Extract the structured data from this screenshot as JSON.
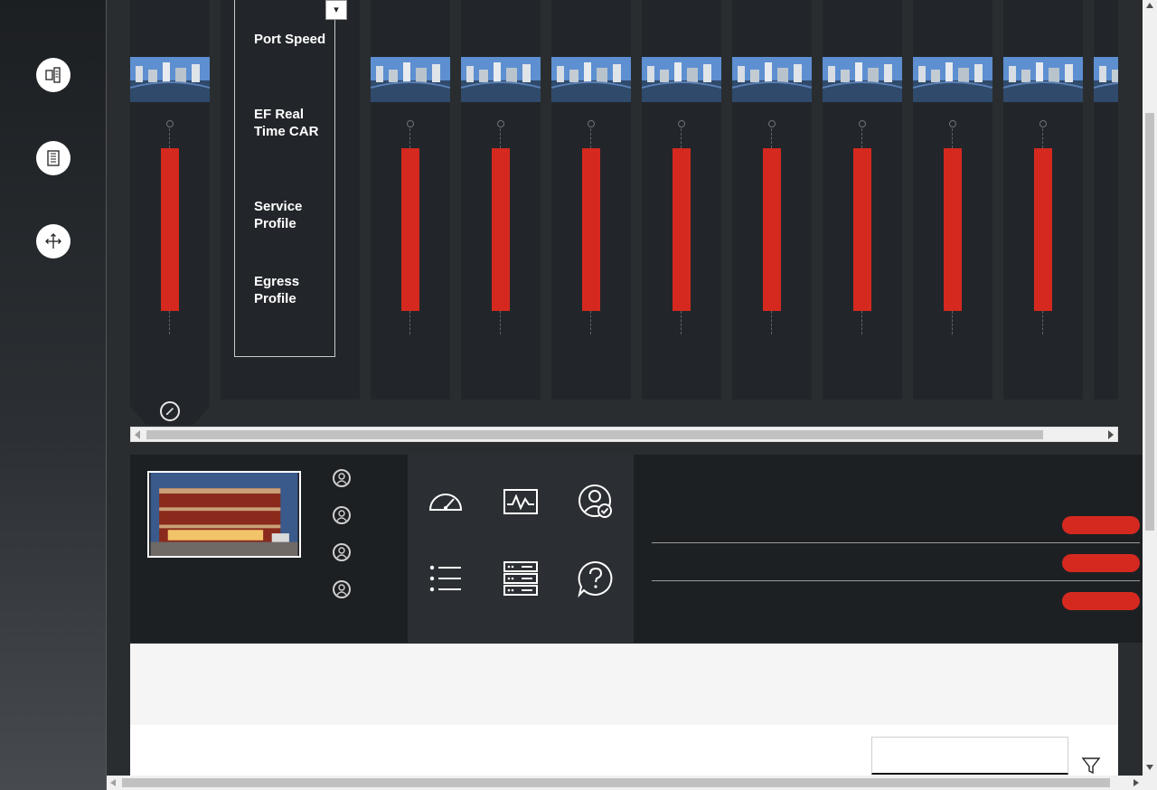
{
  "rail": {
    "buttons": [
      {
        "icon": "topology-icon"
      },
      {
        "icon": "building-icon"
      },
      {
        "icon": "move-arrows-icon"
      }
    ]
  },
  "port_panel": {
    "dropdown_symbol": "▾",
    "labels": [
      "Port Speed",
      "EF Real Time CAR",
      "Service Profile",
      "Egress Profile"
    ],
    "column_count": 10,
    "bar_color": "#d5291f"
  },
  "dashboard": {
    "tools": [
      {
        "icon": "speedometer-icon"
      },
      {
        "icon": "pulse-monitor-icon"
      },
      {
        "icon": "user-check-icon"
      },
      {
        "icon": "list-icon"
      },
      {
        "icon": "server-rack-icon"
      },
      {
        "icon": "help-chat-icon"
      }
    ],
    "avatars": 4,
    "status_pills": 3,
    "accent_color": "#d5291f"
  },
  "filter": {
    "value": "",
    "icon": "filter-icon"
  }
}
